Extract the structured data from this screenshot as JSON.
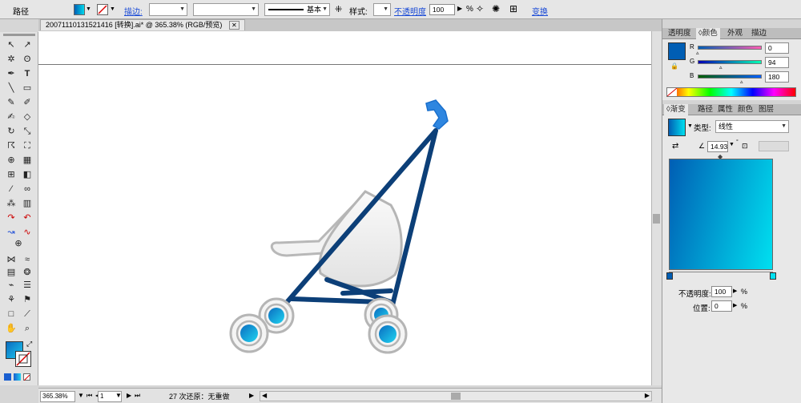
{
  "control_bar": {
    "path_label": "路径",
    "stroke_link": "描边:",
    "stroke_profile": "基本",
    "style_label": "样式:",
    "opacity_link": "不透明度",
    "opacity_value": "100",
    "opacity_unit": "%",
    "transform_link": "变换"
  },
  "document": {
    "tab_title": "20071110131521416  [转换].ai* @ 365.38% (RGB/预览)"
  },
  "status_bar": {
    "zoom": "365.38%",
    "page": "1",
    "undo_text": "27 次还原：无重做"
  },
  "color_panel": {
    "tabs": [
      "透明度",
      "颜色",
      "外观",
      "描边"
    ],
    "active_tab": "颜色",
    "r_label": "R",
    "g_label": "G",
    "b_label": "B",
    "r_value": "0",
    "g_value": "94",
    "b_value": "180",
    "fill_color": "#005eb4"
  },
  "gradient_panel": {
    "tabs": [
      "渐变",
      "路径",
      "属性",
      "颜色",
      "图层"
    ],
    "active_tab": "渐变",
    "type_label": "类型:",
    "type_value": "线性",
    "angle_value": "14.93",
    "opacity_label": "不透明度:",
    "opacity_value": "100",
    "opacity_unit": "%",
    "location_label": "位置:",
    "location_value": "0",
    "location_unit": "%",
    "start_color": "#005eb4",
    "end_color": "#00e0f0"
  }
}
